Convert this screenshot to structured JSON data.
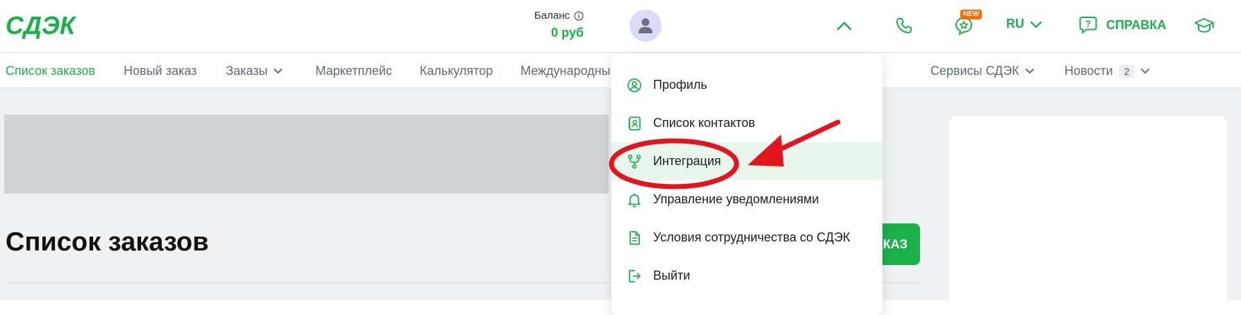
{
  "brand": {
    "logo_text": "СДЭК",
    "color": "#1ab248"
  },
  "header": {
    "balance_label": "Баланс",
    "balance_value": "0 руб",
    "new_badge": "NEW",
    "language": "RU",
    "help_label": "СПРАВКА"
  },
  "nav": {
    "items": [
      {
        "label": "Список заказов"
      },
      {
        "label": "Новый заказ"
      },
      {
        "label": "Заказы"
      },
      {
        "label": "Маркетплейс"
      },
      {
        "label": "Калькулятор"
      },
      {
        "label": "Международны"
      },
      {
        "label": "Сервисы СДЭК"
      },
      {
        "label": "Новости"
      }
    ],
    "news_count": "2"
  },
  "main": {
    "page_title": "Список заказов",
    "new_order_button_fragment": "КАЗ"
  },
  "dropdown": {
    "items": [
      {
        "label": "Профиль",
        "icon": "profile-icon"
      },
      {
        "label": "Список контактов",
        "icon": "contacts-icon"
      },
      {
        "label": "Интеграция",
        "icon": "integration-icon"
      },
      {
        "label": "Управление уведомлениями",
        "icon": "bell-icon"
      },
      {
        "label": "Условия сотрудничества со СДЭК",
        "icon": "document-icon"
      },
      {
        "label": "Выйти",
        "icon": "logout-icon"
      }
    ],
    "highlighted_index": 2,
    "highlight_color": "#e9f6ec"
  },
  "annotation": {
    "color": "#e3141b"
  }
}
